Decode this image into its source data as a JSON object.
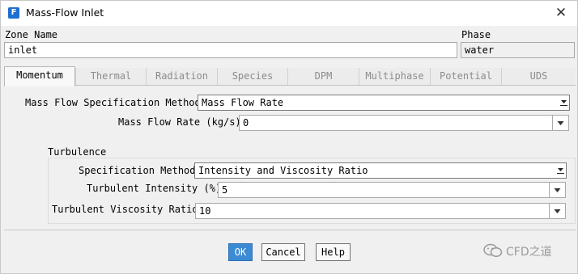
{
  "window": {
    "title": "Mass-Flow Inlet",
    "icon_letter": "F"
  },
  "zone": {
    "label": "Zone Name",
    "value": "inlet"
  },
  "phase": {
    "label": "Phase",
    "value": "water"
  },
  "tabs": [
    {
      "label": "Momentum",
      "active": true
    },
    {
      "label": "Thermal",
      "active": false
    },
    {
      "label": "Radiation",
      "active": false
    },
    {
      "label": "Species",
      "active": false
    },
    {
      "label": "DPM",
      "active": false
    },
    {
      "label": "Multiphase",
      "active": false
    },
    {
      "label": "Potential",
      "active": false
    },
    {
      "label": "UDS",
      "active": false
    }
  ],
  "momentum": {
    "spec_method_label": "Mass Flow Specification Method",
    "spec_method_value": "Mass Flow Rate",
    "mass_flow_label": "Mass Flow Rate (kg/s)",
    "mass_flow_value": "0"
  },
  "turbulence": {
    "group_label": "Turbulence",
    "spec_method_label": "Specification Method",
    "spec_method_value": "Intensity and Viscosity Ratio",
    "intensity_label": "Turbulent Intensity (%)",
    "intensity_value": "5",
    "viscosity_label": "Turbulent Viscosity Ratio",
    "viscosity_value": "10"
  },
  "buttons": {
    "ok": "OK",
    "cancel": "Cancel",
    "help": "Help"
  },
  "watermark": {
    "text": "CFD之道"
  },
  "colors": {
    "accent": "#3c8ad4",
    "icon": "#1e6fd0"
  }
}
